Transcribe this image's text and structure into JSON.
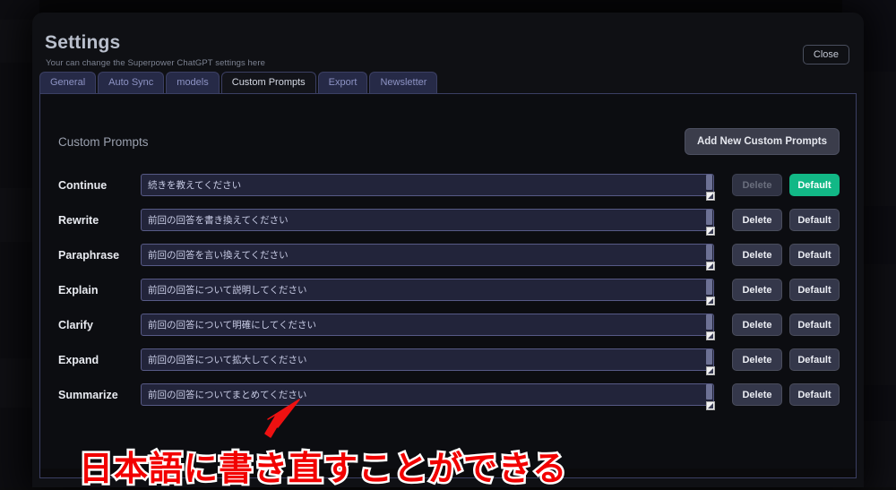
{
  "window": {
    "title": "Settings",
    "subtitle": "Your can change the Superpower ChatGPT settings here",
    "close_label": "Close"
  },
  "tabs": [
    {
      "label": "General",
      "active": false
    },
    {
      "label": "Auto Sync",
      "active": false
    },
    {
      "label": "models",
      "active": false
    },
    {
      "label": "Custom Prompts",
      "active": true
    },
    {
      "label": "Export",
      "active": false
    },
    {
      "label": "Newsletter",
      "active": false
    }
  ],
  "section": {
    "title": "Custom Prompts",
    "add_button_label": "Add New Custom Prompts"
  },
  "buttons": {
    "delete_label": "Delete",
    "default_label": "Default"
  },
  "prompts": [
    {
      "label": "Continue",
      "value": "続きを教えてください",
      "delete_disabled": true,
      "default_active": true
    },
    {
      "label": "Rewrite",
      "value": "前回の回答を書き換えてください",
      "delete_disabled": false,
      "default_active": false
    },
    {
      "label": "Paraphrase",
      "value": "前回の回答を言い換えてください",
      "delete_disabled": false,
      "default_active": false
    },
    {
      "label": "Explain",
      "value": "前回の回答について説明してください",
      "delete_disabled": false,
      "default_active": false
    },
    {
      "label": "Clarify",
      "value": "前回の回答について明確にしてください",
      "delete_disabled": false,
      "default_active": false
    },
    {
      "label": "Expand",
      "value": "前回の回答について拡大してください",
      "delete_disabled": false,
      "default_active": false
    },
    {
      "label": "Summarize",
      "value": "前回の回答についてまとめてください",
      "delete_disabled": false,
      "default_active": false
    }
  ],
  "annotation": {
    "caption": "日本語に書き直すことができる",
    "arrow_color": "#ee1111",
    "caption_color": "#f20000",
    "caption_outline_color": "#ffffff"
  },
  "colors": {
    "accent_green": "#12b886",
    "tab_blue": "#262a47",
    "panel_border": "#3b3f63",
    "modal_bg": "#0f1014",
    "input_bg": "#22243a",
    "input_border": "#575a86"
  }
}
